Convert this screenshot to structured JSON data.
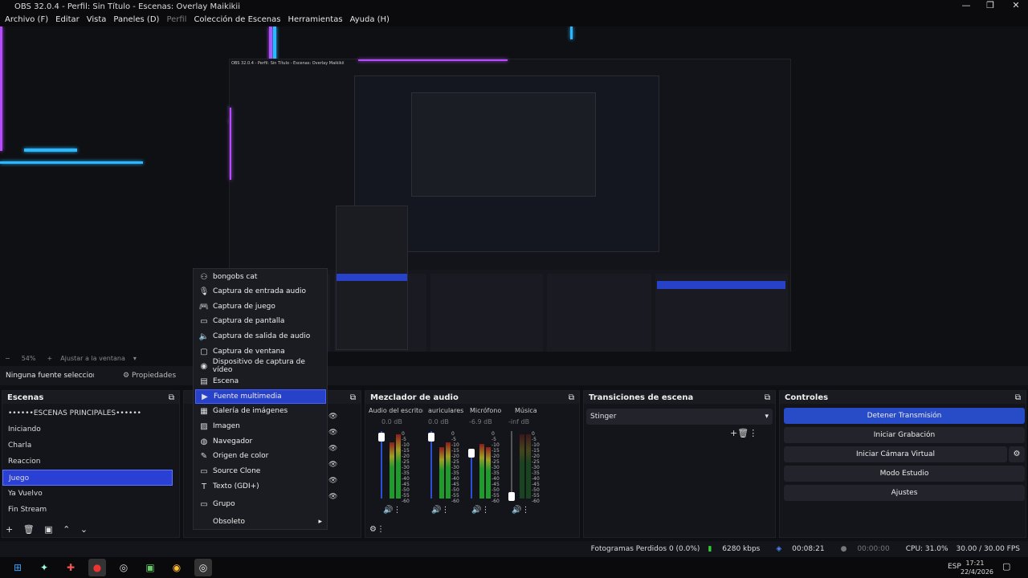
{
  "window": {
    "title": "OBS 32.0.4 - Perfil: Sin Título - Escenas: Overlay Maikikii",
    "controls": [
      "—",
      "❐",
      "✕"
    ]
  },
  "menubar": {
    "items": [
      "Archivo (F)",
      "Editar",
      "Vista",
      "Paneles (D)",
      "Perfil",
      "Colección de Escenas",
      "Herramientas",
      "Ayuda (H)"
    ]
  },
  "preview": {
    "zoom": "54%",
    "fit_label": "Ajustar a la ventana"
  },
  "sources_toolbar": {
    "no_source": "Ninguna fuente seleccionada",
    "properties": "Propiedades"
  },
  "scenes": {
    "title": "Escenas",
    "items": [
      "••••••ESCENAS PRINCIPALES••••••",
      "Iniciando",
      "Charla",
      "Reaccion",
      "Juego",
      "Ya Vuelvo",
      "Fin Stream"
    ],
    "selected_index": 4
  },
  "context_menu": {
    "items": [
      {
        "label": "bongobs cat",
        "icon": "bongo-icon"
      },
      {
        "label": "Captura de entrada audio",
        "icon": "mic-icon"
      },
      {
        "label": "Captura de juego",
        "icon": "gamepad-icon"
      },
      {
        "label": "Captura de pantalla",
        "icon": "monitor-icon"
      },
      {
        "label": "Captura de salida de audio",
        "icon": "speaker-icon"
      },
      {
        "label": "Captura de ventana",
        "icon": "window-icon"
      },
      {
        "label": "Dispositivo de captura de vídeo",
        "icon": "camera-icon"
      },
      {
        "label": "Escena",
        "icon": "scene-icon"
      },
      {
        "label": "Fuente multimedia",
        "icon": "play-icon"
      },
      {
        "label": "Galería de imágenes",
        "icon": "gallery-icon"
      },
      {
        "label": "Imagen",
        "icon": "image-icon"
      },
      {
        "label": "Navegador",
        "icon": "globe-icon"
      },
      {
        "label": "Origen de color",
        "icon": "brush-icon"
      },
      {
        "label": "Source Clone",
        "icon": "clone-icon"
      },
      {
        "label": "Texto (GDI+)",
        "icon": "text-icon"
      },
      {
        "label": "Grupo",
        "icon": "folder-icon"
      },
      {
        "label": "Obsoleto",
        "icon": ""
      }
    ],
    "highlighted_index": 8
  },
  "mixer": {
    "title": "Mezclador de audio",
    "channels": [
      {
        "name": "Audio del escritorio",
        "db": "0.0 dB"
      },
      {
        "name": "auriculares",
        "db": "0.0 dB"
      },
      {
        "name": "Micrófono",
        "db": "-6.9 dB"
      },
      {
        "name": "Música",
        "db": "-inf dB"
      }
    ],
    "scale": [
      "0",
      "-5",
      "-10",
      "-15",
      "-20",
      "-25",
      "-30",
      "-35",
      "-40",
      "-45",
      "-50",
      "-55",
      "-60"
    ]
  },
  "transitions": {
    "title": "Transiciones de escena",
    "selected": "Stinger"
  },
  "controls": {
    "title": "Controles",
    "buttons": [
      "Detener Transmisión",
      "Iniciar Grabación",
      "Iniciar Cámara Virtual",
      "Modo Estudio",
      "Ajustes"
    ]
  },
  "statusbar": {
    "dropped": "Fotogramas Perdidos 0 (0.0%)",
    "bitrate": "6280 kbps",
    "stream_time": "00:08:21",
    "rec_time": "00:00:00",
    "cpu": "CPU: 31.0%",
    "fps": "30.00 / 30.00 FPS"
  },
  "taskbar": {
    "lang": "ESP",
    "time": "17:21",
    "date": "22/4/2026"
  },
  "colors": {
    "accent": "#2841c9",
    "glow_purple": "#b84bff",
    "glow_cyan": "#2bb8ff"
  }
}
